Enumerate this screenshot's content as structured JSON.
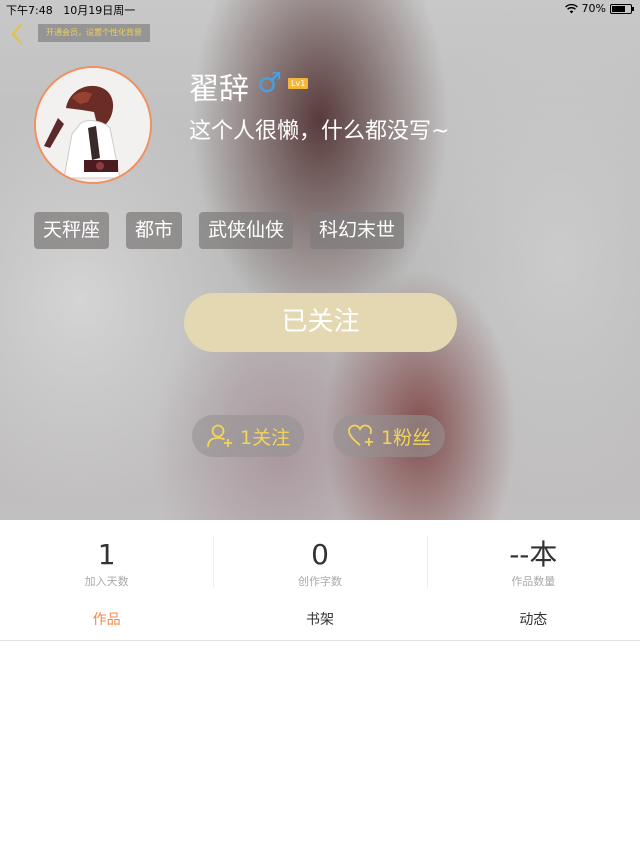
{
  "status_bar": {
    "time": "下午7:48",
    "date": "10月19日周一",
    "battery": "70%",
    "battery_level": 0.7
  },
  "header": {
    "vip_banner": "开通会员，设置个性化背景"
  },
  "profile": {
    "name": "翟辞",
    "gender_symbol": "♂",
    "level": "Lv1",
    "bio": "这个人很懒，什么都没写~",
    "tags": [
      "天秤座",
      "都市",
      "武侠仙侠",
      "科幻末世"
    ],
    "follow_button": "已关注",
    "following": "1关注",
    "fans": "1粉丝"
  },
  "stats": [
    {
      "value": "1",
      "label": "加入天数"
    },
    {
      "value": "0",
      "label": "创作字数"
    },
    {
      "value": "--本",
      "label": "作品数量"
    }
  ],
  "tabs": [
    "作品",
    "书架",
    "动态"
  ],
  "colors": {
    "accent": "#f08a4b",
    "gold": "#f1d55a",
    "follow_btn": "#e3d8b2",
    "male": "#4a9fe0"
  }
}
